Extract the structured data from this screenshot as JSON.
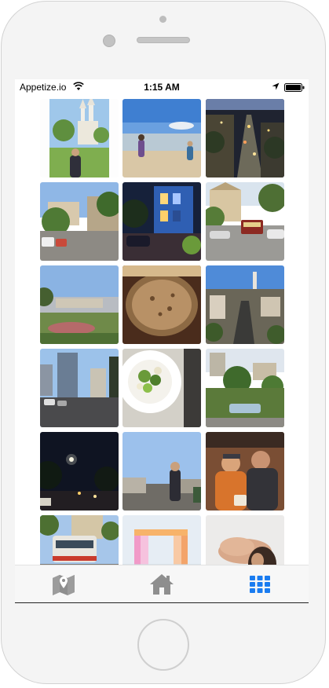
{
  "status_bar": {
    "carrier": "Appetize.io",
    "time": "1:15 AM"
  },
  "tab_bar": {
    "items": [
      {
        "icon": "map-icon",
        "selected": false
      },
      {
        "icon": "home-icon",
        "selected": false
      },
      {
        "icon": "grid-icon",
        "selected": true
      }
    ],
    "active_color": "#1a7cf0",
    "inactive_color": "#8e8e8e"
  },
  "photos": [
    {
      "subject": "church-portrait"
    },
    {
      "subject": "beach-girls"
    },
    {
      "subject": "lombard-street-night"
    },
    {
      "subject": "city-street-view"
    },
    {
      "subject": "blue-house-night"
    },
    {
      "subject": "cable-car-street"
    },
    {
      "subject": "city-overlook"
    },
    {
      "subject": "food-closeup"
    },
    {
      "subject": "coit-tower-view"
    },
    {
      "subject": "downtown-street"
    },
    {
      "subject": "salad-plate"
    },
    {
      "subject": "lombard-hedges"
    },
    {
      "subject": "night-moon"
    },
    {
      "subject": "city-selfie"
    },
    {
      "subject": "couple-restaurant"
    },
    {
      "subject": "muni-bus"
    },
    {
      "subject": "wedding-arch"
    },
    {
      "subject": "hands-closeup"
    }
  ]
}
